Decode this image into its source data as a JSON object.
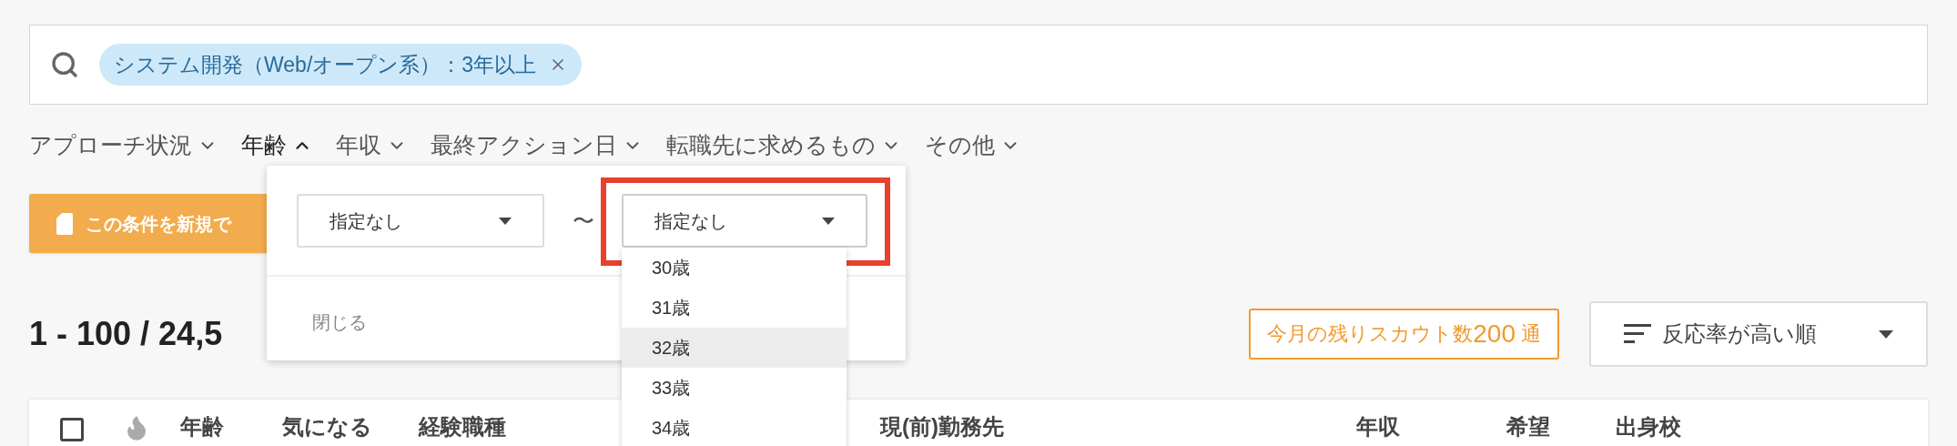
{
  "search": {
    "tags": [
      {
        "label": "システム開発（Web/オープン系）：3年以上",
        "removable": true
      }
    ]
  },
  "filters": [
    {
      "label": "アプローチ状況",
      "expanded": false
    },
    {
      "label": "年齢",
      "expanded": true
    },
    {
      "label": "年収",
      "expanded": false
    },
    {
      "label": "最終アクション日",
      "expanded": false
    },
    {
      "label": "転職先に求めるもの",
      "expanded": false
    },
    {
      "label": "その他",
      "expanded": false
    }
  ],
  "save_button": {
    "label": "この条件を新規で"
  },
  "age_popover": {
    "from": {
      "value": "指定なし"
    },
    "separator": "〜",
    "to": {
      "value": "指定なし",
      "highlighted": true,
      "open": true,
      "options": [
        {
          "label": "30歳",
          "selected": false
        },
        {
          "label": "31歳",
          "selected": false
        },
        {
          "label": "32歳",
          "selected": true
        },
        {
          "label": "33歳",
          "selected": false
        },
        {
          "label": "34歳",
          "selected": false
        }
      ]
    },
    "close": "閉じる"
  },
  "result_count": "1 - 100 / 24,5",
  "scout_remaining": {
    "prefix": "今月の残りスカウト数",
    "count": "200",
    "suffix": "通"
  },
  "sort": {
    "label": "反応率が高い順"
  },
  "table": {
    "columns": [
      {
        "kind": "checkbox",
        "checked": false
      },
      {
        "kind": "icon"
      },
      {
        "kind": "text",
        "label": "年齢"
      },
      {
        "kind": "text",
        "label": "気になる"
      },
      {
        "kind": "text",
        "label": "経験職種"
      },
      {
        "kind": "text",
        "label": "現(前)勤務先"
      },
      {
        "kind": "text",
        "label": "年収"
      },
      {
        "kind": "text",
        "label": "希望"
      },
      {
        "kind": "text",
        "label": "出身校"
      }
    ]
  }
}
